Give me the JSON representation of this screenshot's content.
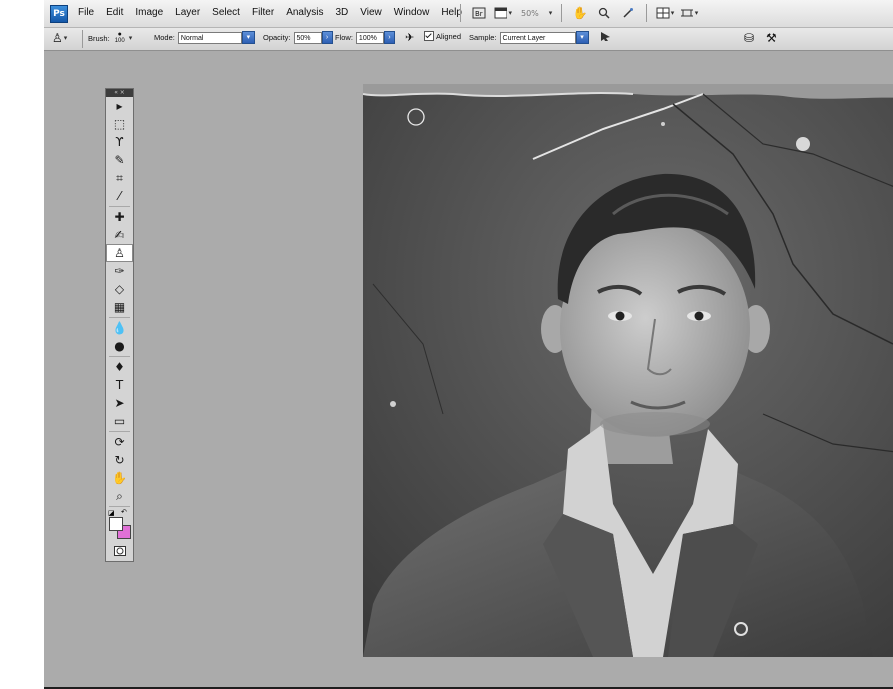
{
  "app": {
    "logo": "Ps"
  },
  "menu": [
    "File",
    "Edit",
    "Image",
    "Layer",
    "Select",
    "Filter",
    "Analysis",
    "3D",
    "View",
    "Window",
    "Help"
  ],
  "menubar_right": {
    "zoom": "50%"
  },
  "icons": {
    "bridge": "bridge-icon",
    "screen_mode": "screen-mode-icon",
    "hand": "hand-tool-icon",
    "zoom": "zoom-tool-icon",
    "rotate": "rotate-view-icon",
    "arrange": "arrange-documents-icon",
    "extras": "extras-icon"
  },
  "options": {
    "brush_label": "Brush:",
    "brush_size": "100",
    "mode_label": "Mode:",
    "mode_value": "Normal",
    "opacity_label": "Opacity:",
    "opacity_value": "50%",
    "flow_label": "Flow:",
    "flow_value": "100%",
    "aligned_label": "Aligned",
    "aligned_checked": true,
    "sample_label": "Sample:",
    "sample_value": "Current Layer"
  },
  "toolbox": {
    "header": "« ×",
    "active_tool": "clone-stamp",
    "tools": [
      {
        "name": "move-tool",
        "glyph": "▸"
      },
      {
        "name": "marquee-tool",
        "glyph": "⬚"
      },
      {
        "name": "lasso-tool",
        "glyph": "ϒ"
      },
      {
        "name": "magic-wand-tool",
        "glyph": "✎"
      },
      {
        "name": "crop-tool",
        "glyph": "⌗"
      },
      {
        "name": "eyedropper-tool",
        "glyph": "⁄"
      },
      {
        "name": "healing-brush-tool",
        "glyph": "✚"
      },
      {
        "name": "brush-tool",
        "glyph": "✍"
      },
      {
        "name": "clone-stamp-tool",
        "glyph": "♙"
      },
      {
        "name": "history-brush-tool",
        "glyph": "✑"
      },
      {
        "name": "eraser-tool",
        "glyph": "◇"
      },
      {
        "name": "gradient-tool",
        "glyph": "▦"
      },
      {
        "name": "blur-tool",
        "glyph": "💧"
      },
      {
        "name": "dodge-tool",
        "glyph": "●"
      },
      {
        "name": "pen-tool",
        "glyph": "♦"
      },
      {
        "name": "type-tool",
        "glyph": "T"
      },
      {
        "name": "path-selection-tool",
        "glyph": "➤"
      },
      {
        "name": "shape-tool",
        "glyph": "▭"
      },
      {
        "name": "3d-rotate-tool",
        "glyph": "⟳"
      },
      {
        "name": "3d-orbit-tool",
        "glyph": "↻"
      },
      {
        "name": "hand-tool",
        "glyph": "✋"
      },
      {
        "name": "zoom-tool",
        "glyph": "⌕"
      }
    ],
    "fg_color": "#ffffff",
    "bg_color": "#e070d6"
  }
}
